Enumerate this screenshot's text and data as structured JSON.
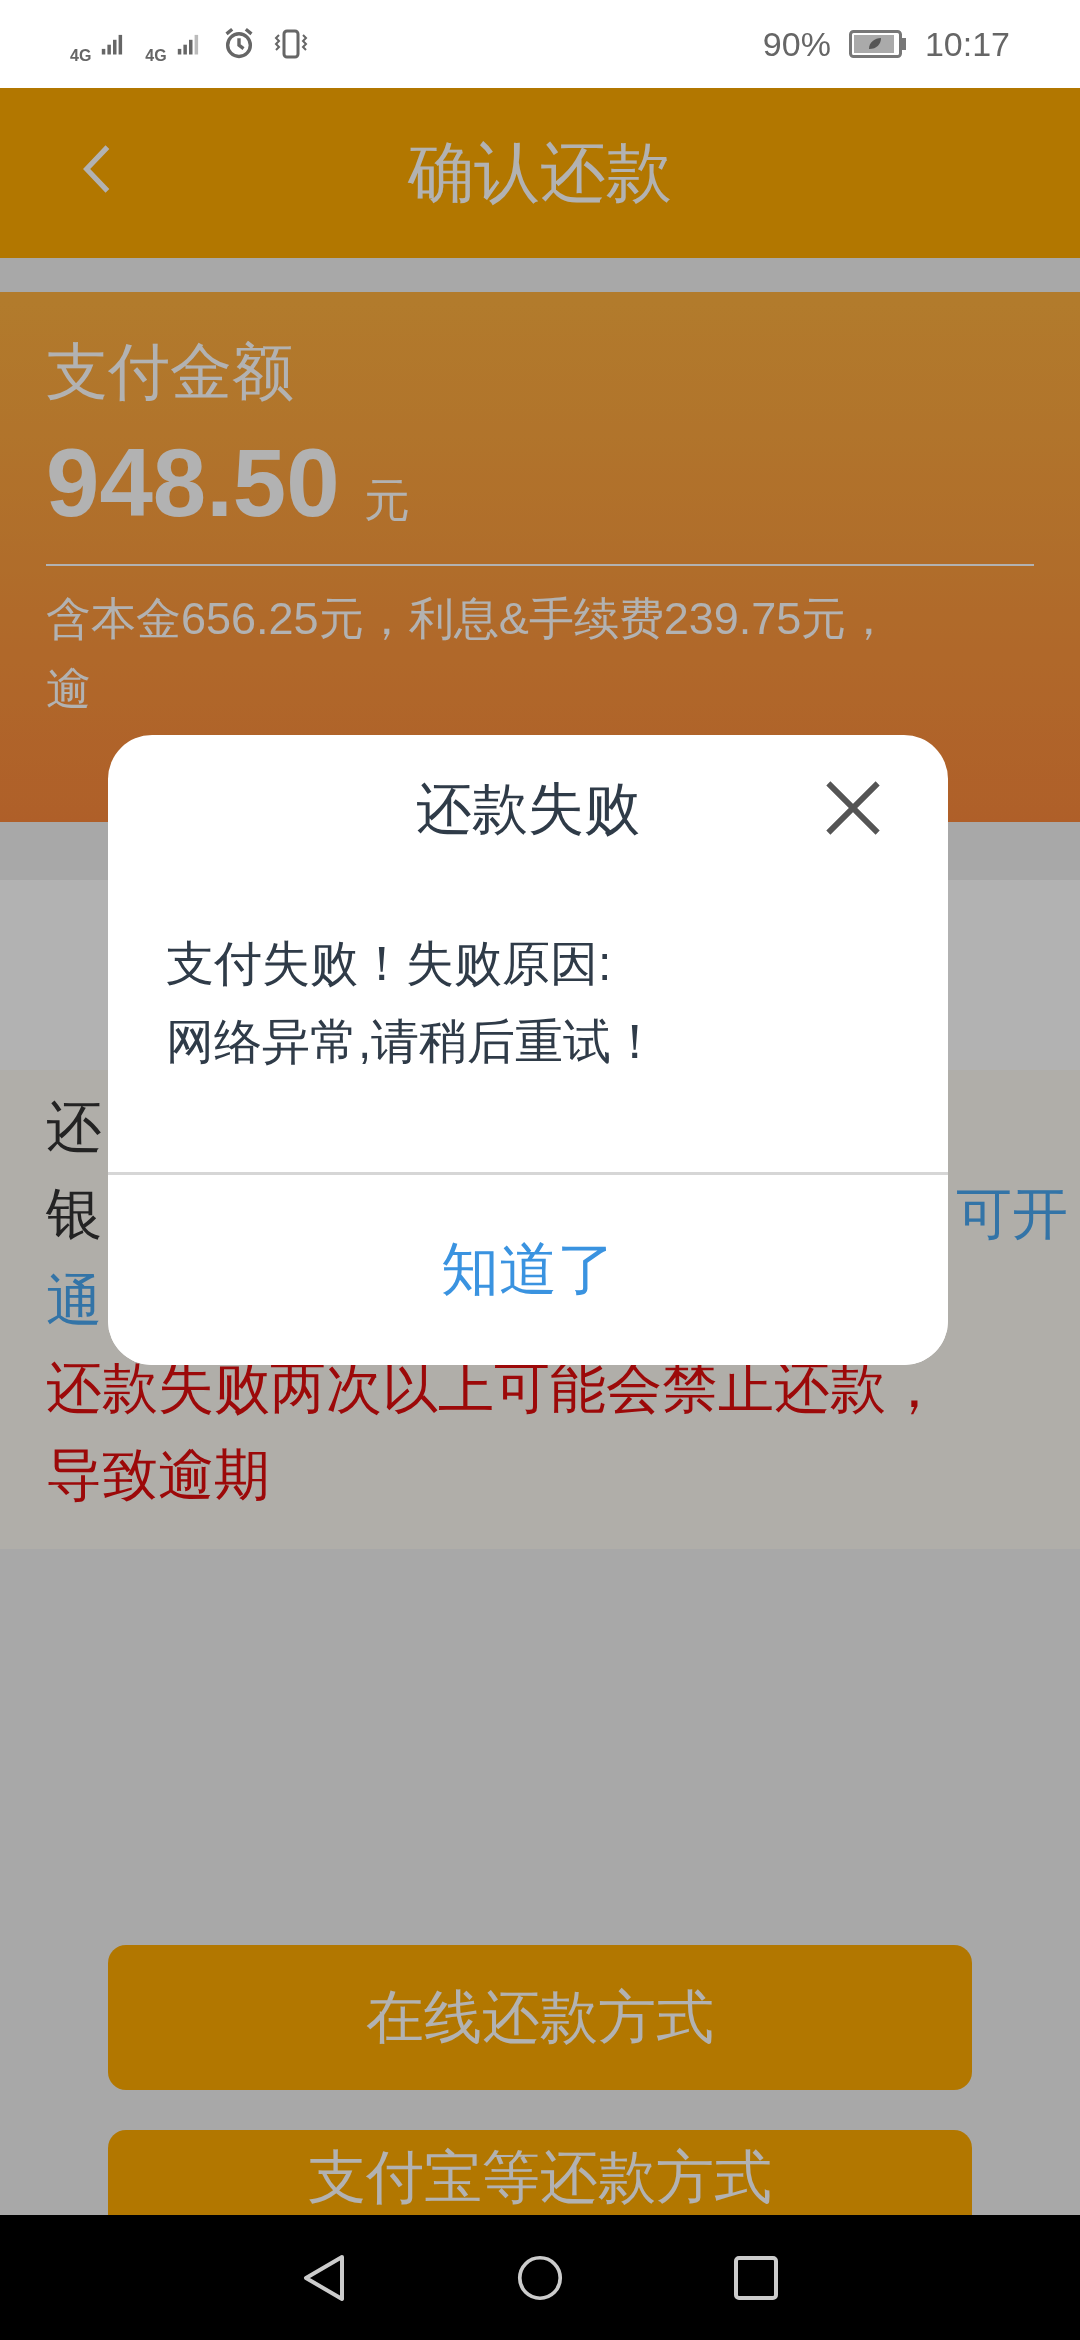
{
  "status_bar": {
    "network_1": "4G",
    "network_2": "4G",
    "battery": "90%",
    "time": "10:17"
  },
  "header": {
    "title": "确认还款"
  },
  "amount_card": {
    "label": "支付金额",
    "amount": "948.50",
    "unit": "元",
    "breakdown_lines": [
      "含本金656.25元，利息&手续费239.75元，",
      "逾"
    ]
  },
  "notice": {
    "lines": [
      {
        "segments": [
          {
            "kind": "text",
            "text": "还"
          }
        ]
      },
      {
        "segments": [
          {
            "kind": "text",
            "text": "银"
          },
          {
            "kind": "link",
            "text": "可开"
          }
        ]
      },
      {
        "segments": [
          {
            "kind": "link",
            "text": "通"
          }
        ]
      },
      {
        "segments": [
          {
            "kind": "warning",
            "text": "还款失败两次以上可能会禁止还款，"
          }
        ]
      },
      {
        "segments": [
          {
            "kind": "warning",
            "text": "导致逾期"
          }
        ]
      }
    ]
  },
  "buttons": [
    "在线还款方式",
    "支付宝等还款方式"
  ],
  "dialog": {
    "title": "还款失败",
    "message_lines": [
      "支付失败！失败原因:",
      "网络异常,请稍后重试！"
    ],
    "button": "知道了"
  }
}
